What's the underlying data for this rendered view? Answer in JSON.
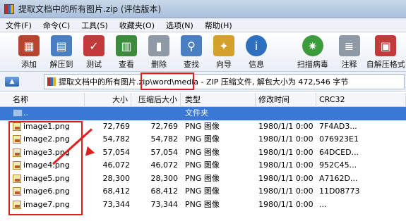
{
  "window": {
    "title": "提取文档中的所有图片.zip (评估版本)"
  },
  "menu": [
    "文件(F)",
    "命令(C)",
    "工具(S)",
    "收藏夹(O)",
    "选项(N)",
    "帮助(H)"
  ],
  "toolbar": [
    {
      "label": "添加",
      "icon": "add-icon",
      "color": "#b8432f"
    },
    {
      "label": "解压到",
      "icon": "extract-icon",
      "color": "#4a7fc2"
    },
    {
      "label": "测试",
      "icon": "test-icon",
      "color": "#c23a3a"
    },
    {
      "label": "查看",
      "icon": "view-icon",
      "color": "#3d8b3d"
    },
    {
      "label": "删除",
      "icon": "delete-icon",
      "color": "#8f9aa6"
    },
    {
      "label": "查找",
      "icon": "find-icon",
      "color": "#4a7fc2"
    },
    {
      "label": "向导",
      "icon": "wizard-icon",
      "color": "#d6a12a"
    },
    {
      "label": "信息",
      "icon": "info-icon",
      "color": "#2f6fc0"
    },
    {
      "label": "扫描病毒",
      "icon": "virus-scan-icon",
      "color": "#3c9c3c"
    },
    {
      "label": "注释",
      "icon": "comment-icon",
      "color": "#8f9aa6"
    },
    {
      "label": "自解压格式",
      "icon": "sfx-icon",
      "color": "#c23a3a"
    }
  ],
  "pathbar": {
    "up_label": "",
    "path_text": "提取文档中的所有图片.zip\\word\\media - ZIP 压缩文件, 解包大小为 472,546 字节"
  },
  "columns": [
    "名称",
    "大小",
    "压缩后大小",
    "类型",
    "修改时间",
    "CRC32"
  ],
  "parent_row": {
    "name": "..",
    "type": "文件夹"
  },
  "files": [
    {
      "name": "image1.png",
      "size": "72,769",
      "packed": "72,769",
      "type": "PNG 图像",
      "modified": "1980/1/1 0:00",
      "crc": "7F4AD3..."
    },
    {
      "name": "image2.png",
      "size": "54,782",
      "packed": "54,782",
      "type": "PNG 图像",
      "modified": "1980/1/1 0:00",
      "crc": "076923E1"
    },
    {
      "name": "image3.png",
      "size": "57,054",
      "packed": "57,054",
      "type": "PNG 图像",
      "modified": "1980/1/1 0:00",
      "crc": "64DCED..."
    },
    {
      "name": "image4.png",
      "size": "46,072",
      "packed": "46,072",
      "type": "PNG 图像",
      "modified": "1980/1/1 0:00",
      "crc": "952C45..."
    },
    {
      "name": "image5.png",
      "size": "28,300",
      "packed": "28,300",
      "type": "PNG 图像",
      "modified": "1980/1/1 0:00",
      "crc": "A7162D..."
    },
    {
      "name": "image6.png",
      "size": "68,412",
      "packed": "68,412",
      "type": "PNG 图像",
      "modified": "1980/1/1 0:00",
      "crc": "11D08773"
    },
    {
      "name": "image7.png",
      "size": "73,344",
      "packed": "73,344",
      "type": "PNG 图像",
      "modified": "1980/1/1 0:00",
      "crc": "..."
    }
  ]
}
